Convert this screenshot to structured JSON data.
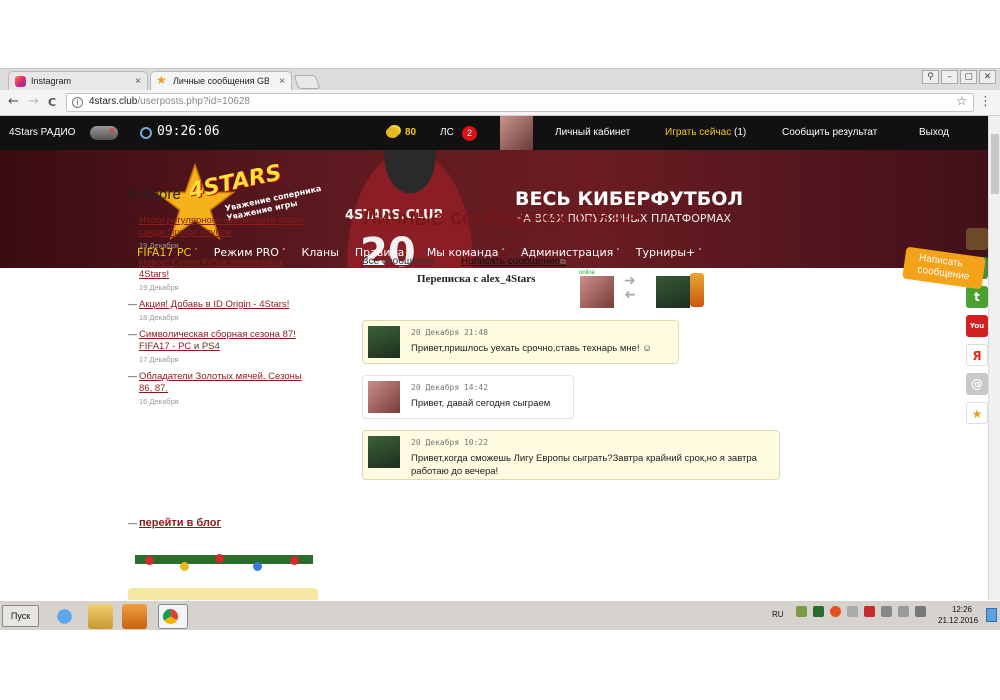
{
  "browser": {
    "tabs": [
      {
        "title": "Instagram",
        "close": "×"
      },
      {
        "title": "Личные сообщения GBale",
        "close": "×"
      }
    ],
    "url_host": "4stars.club",
    "url_path": "/userposts.php?id=10628",
    "nav": {
      "back": "←",
      "forward": "→",
      "reload": "C"
    },
    "icons": {
      "info": "i",
      "star": "☆",
      "menu": "⋮"
    },
    "window_buttons": [
      "⚲",
      "–",
      "▢",
      "✕"
    ]
  },
  "sitebar": {
    "radio_label": "4Stars РАДИО",
    "time": "09:26:06",
    "coins": "80",
    "ls_label": "ЛС",
    "ls_count": "2",
    "cabinet": "Личный кабинет",
    "play_now": "Играть сейчас",
    "play_now_count": "(1)",
    "report_result": "Сообщить результат",
    "logout": "Выход"
  },
  "banner": {
    "logo_text": "4STARS",
    "logo_tag1": "Уважение соперника",
    "logo_tag2": "Уважение игры",
    "shirt_text": "4STARS.CLUB",
    "shirt_number": "20",
    "slogan_main": "ВЕСЬ КИБЕРФУТБОЛ",
    "slogan_sub": "НА ВСЕХ ПОПУЛЯРНЫХ ПЛАТФОРМАХ",
    "nav": [
      {
        "label": "FIFA17 PC",
        "chevron": "˅"
      },
      {
        "label": "Режим PRO",
        "chevron": "˅"
      },
      {
        "label": "Кланы",
        "chevron": ""
      },
      {
        "label": "Правила",
        "chevron": "˅"
      },
      {
        "label": "Мы команда",
        "chevron": "˅"
      },
      {
        "label": "Администрация",
        "chevron": "˅"
      },
      {
        "label": "Турниры+",
        "chevron": "˅"
      }
    ]
  },
  "sidebar": {
    "title": "В блоге",
    "posts": [
      {
        "title": "Итоги регулярного чемпионата 4stars среди Профи клубов",
        "date": "19 Декабря"
      },
      {
        "title": "Новое! Супер Кубок чемпионата 4Stars!",
        "date": "19 Декабря"
      },
      {
        "title": "Акция! Добавь в ID Origin - 4Stars!",
        "date": "18 Декабря"
      },
      {
        "title": "Символическая сборная сезона 87! FIFA17 - PC и PS4",
        "date": "17 Декабря"
      },
      {
        "title": "Обладатели Золотых мячей. Сезоны 86, 87.",
        "date": "16 Декабря"
      }
    ],
    "to_blog": "перейти в блог"
  },
  "main": {
    "heading": "Личные сообщения GBale",
    "all_messages": "Все сообщения",
    "write_message": "Написать сообщение",
    "write_message_ext": "⧉",
    "conversation_with": "Переписка с alex_4Stars",
    "online_label": "online",
    "messages": [
      {
        "date": "20 Декабря 21:48",
        "text": "Привет,пришлось уехать срочно,ставь технарь мне! ☺",
        "from": "them"
      },
      {
        "date": "20 Декабря 14:42",
        "text": "Привет, давай сегодня сыграем",
        "from": "me"
      },
      {
        "date": "20 Декабря 10:22",
        "text": "Привет,когда сможешь Лигу Европы сыграть?Завтра крайний срок,но я завтра работаю до вечера!",
        "from": "them"
      }
    ]
  },
  "floaters": {
    "social": [
      {
        "name": "hat",
        "label": "",
        "color": "#6b4a2a"
      },
      {
        "name": "vk",
        "label": "В",
        "color": "#4a8a3a"
      },
      {
        "name": "twitter",
        "label": "t",
        "color": "#4aa030"
      },
      {
        "name": "youtube",
        "label": "You",
        "color": "#d02020"
      },
      {
        "name": "yandex",
        "label": "Я",
        "color": "#e03020"
      },
      {
        "name": "mail",
        "label": "@",
        "color": "#c8c8c8"
      },
      {
        "name": "star",
        "label": "★",
        "color": "#e8a020"
      }
    ],
    "write_float": "Написать сообщение"
  },
  "taskbar": {
    "start": "Пуск",
    "lang": "RU",
    "time": "12:26",
    "date": "21.12.2016"
  },
  "colors": {
    "accent": "#7a1414",
    "gold": "#f5c518",
    "banner": "#5e1a20"
  }
}
